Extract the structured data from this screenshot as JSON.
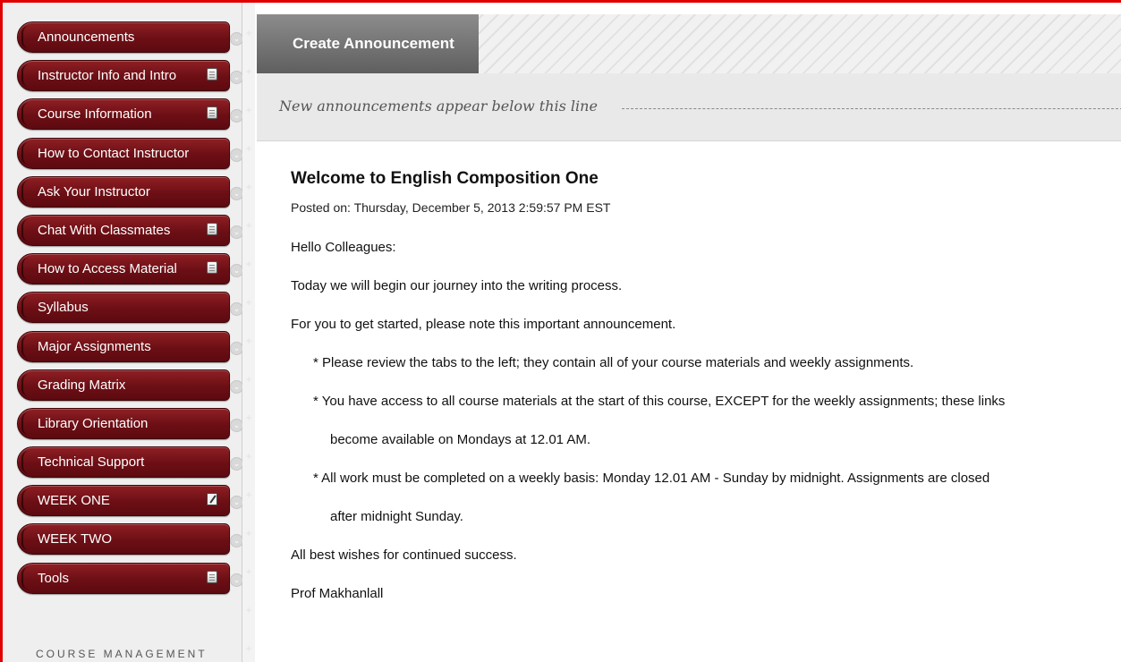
{
  "sidebar": {
    "items": [
      {
        "label": "Announcements",
        "icon": "none"
      },
      {
        "label": "Instructor Info and Intro",
        "icon": "page"
      },
      {
        "label": "Course Information",
        "icon": "page"
      },
      {
        "label": "How to Contact Instructor",
        "icon": "none"
      },
      {
        "label": "Ask Your Instructor",
        "icon": "none"
      },
      {
        "label": "Chat With Classmates",
        "icon": "page"
      },
      {
        "label": "How to Access Material",
        "icon": "page"
      },
      {
        "label": "Syllabus",
        "icon": "none"
      },
      {
        "label": "Major Assignments",
        "icon": "none"
      },
      {
        "label": "Grading Matrix",
        "icon": "none"
      },
      {
        "label": "Library Orientation",
        "icon": "none"
      },
      {
        "label": "Technical Support",
        "icon": "none"
      },
      {
        "label": "WEEK ONE",
        "icon": "edit"
      },
      {
        "label": "WEEK TWO",
        "icon": "none"
      },
      {
        "label": "Tools",
        "icon": "page"
      }
    ],
    "course_management_label": "COURSE MANAGEMENT"
  },
  "tabbar": {
    "create_label": "Create Announcement"
  },
  "notice": {
    "text": "New announcements appear below this line"
  },
  "announcement": {
    "title": "Welcome to English Composition One",
    "posted": "Posted on: Thursday, December 5, 2013 2:59:57 PM EST",
    "greeting": "Hello Colleagues:",
    "line1": "Today we will begin our journey into the writing process.",
    "line2": "For you to get started, please note this important announcement.",
    "bullet1": "* Please review the tabs to the left; they contain all of your course materials and weekly assignments.",
    "bullet2a": "* You have access to all course materials at the start of this course, EXCEPT for the weekly assignments; these links",
    "bullet2b": "become available on Mondays at 12.01 AM.",
    "bullet3a": "* All work must be completed on a weekly basis: Monday 12.01 AM - Sunday by midnight.  Assignments are closed",
    "bullet3b": "after midnight Sunday.",
    "closing": "All best wishes for continued success.",
    "signature": "Prof Makhanlall"
  },
  "colors": {
    "nav_pill": "#7a141a",
    "tab_active": "#707070",
    "frame_border": "#e00000"
  }
}
